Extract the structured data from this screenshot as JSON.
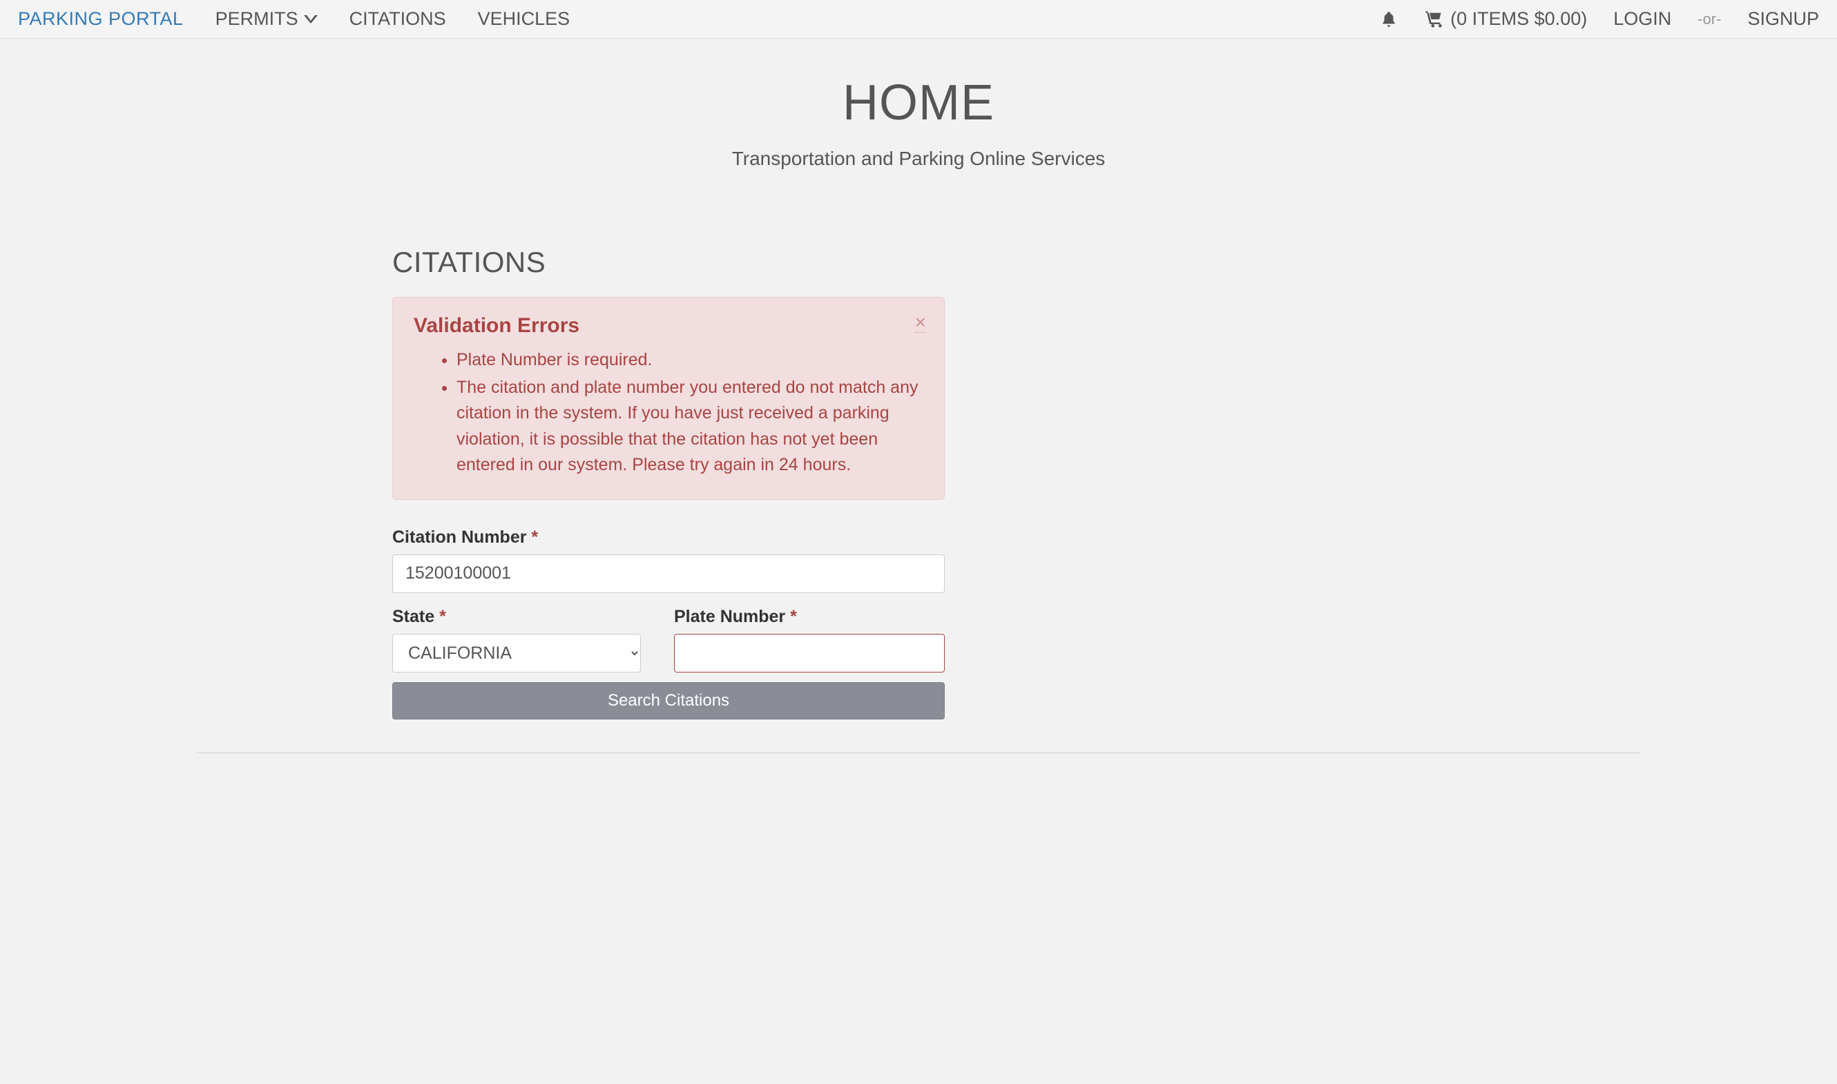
{
  "nav": {
    "brand": "PARKING PORTAL",
    "permits": "PERMITS",
    "citations": "CITATIONS",
    "vehicles": "VEHICLES",
    "cart": "(0 ITEMS $0.00)",
    "login": "LOGIN",
    "or": "-or-",
    "signup": "SIGNUP"
  },
  "page": {
    "title": "HOME",
    "subtitle": "Transportation and Parking Online Services"
  },
  "citations": {
    "heading": "CITATIONS",
    "alert": {
      "title": "Validation Errors",
      "errors": [
        "Plate Number is required.",
        "The citation and plate number you entered do not match any citation in the system. If you have just received a parking violation, it is possible that the citation has not yet been entered in our system. Please try again in 24 hours."
      ]
    },
    "form": {
      "citation_label": "Citation Number",
      "citation_value": "15200100001",
      "state_label": "State",
      "state_value": "CALIFORNIA",
      "plate_label": "Plate Number",
      "plate_value": "",
      "required_mark": "*",
      "submit_label": "Search Citations"
    }
  }
}
